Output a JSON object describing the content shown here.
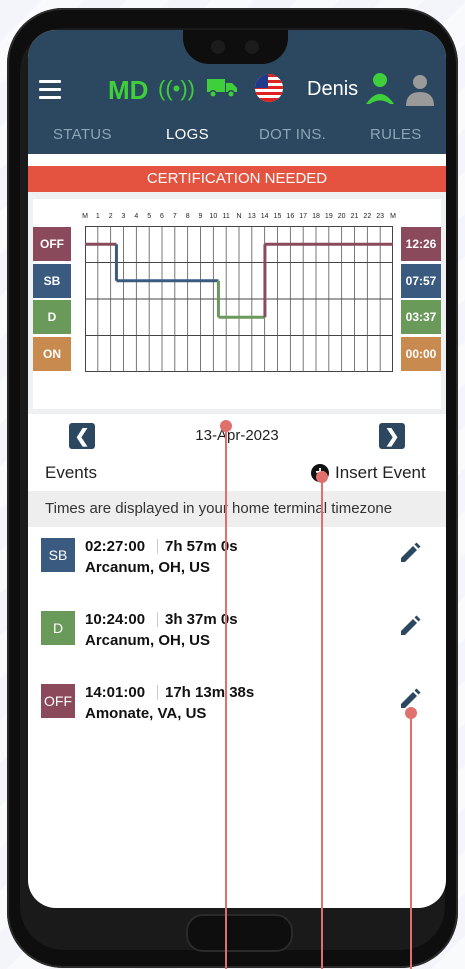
{
  "header": {
    "app_label": "MD",
    "signal_glyph": "((•))",
    "user_name": "Denis"
  },
  "tabs": [
    {
      "label": "STATUS"
    },
    {
      "label": "LOGS"
    },
    {
      "label": "DOT INS."
    },
    {
      "label": "RULES"
    }
  ],
  "banner": {
    "text": "CERTIFICATION NEEDED"
  },
  "chart": {
    "hours": [
      "M",
      "1",
      "2",
      "3",
      "4",
      "5",
      "6",
      "7",
      "8",
      "9",
      "10",
      "11",
      "N",
      "13",
      "14",
      "15",
      "16",
      "17",
      "18",
      "19",
      "20",
      "21",
      "22",
      "23",
      "M"
    ],
    "statuses": [
      {
        "label": "OFF",
        "color": "#8a4a5c",
        "total": "12:26"
      },
      {
        "label": "SB",
        "color": "#3a5a80",
        "total": "07:57"
      },
      {
        "label": "D",
        "color": "#6a9a5a",
        "total": "03:37"
      },
      {
        "label": "ON",
        "color": "#c98a50",
        "total": "00:00"
      }
    ]
  },
  "chart_data": {
    "type": "line",
    "x_unit": "hours",
    "xlim": [
      0,
      24
    ],
    "rows": [
      "OFF",
      "SB",
      "D",
      "ON"
    ],
    "segments": [
      {
        "status": "OFF",
        "start": 0,
        "end": 2.45
      },
      {
        "status": "SB",
        "start": 2.45,
        "end": 10.4
      },
      {
        "status": "D",
        "start": 10.4,
        "end": 14.02
      },
      {
        "status": "OFF",
        "start": 14.02,
        "end": 24
      }
    ]
  },
  "date_nav": {
    "date": "13-Apr-2023",
    "prev_glyph": "❮",
    "next_glyph": "❯"
  },
  "events_section": {
    "title": "Events",
    "insert_label": "Insert Event",
    "insert_glyph": "+"
  },
  "timezone_note": "Times are displayed in your home terminal timezone",
  "events": [
    {
      "status": "SB",
      "color": "#3a5a80",
      "time": "02:27:00",
      "duration": "7h 57m 0s",
      "location": "Arcanum, OH, US"
    },
    {
      "status": "D",
      "color": "#6a9a5a",
      "time": "10:24:00",
      "duration": "3h 37m 0s",
      "location": "Arcanum, OH, US"
    },
    {
      "status": "OFF",
      "color": "#8a4a5c",
      "time": "14:01:00",
      "duration": "17h 13m 38s",
      "location": "Amonate, VA, US"
    }
  ],
  "icons": {
    "menu": "hamburger-icon",
    "signal": "signal-icon",
    "truck": "truck-icon",
    "flag": "us-flag-icon",
    "driver": "driver-icon",
    "codriver": "codriver-icon",
    "edit": "pencil-icon"
  },
  "colors": {
    "appbar": "#2b4860",
    "accent_green": "#3ecf3a",
    "banner": "#e4533f"
  }
}
